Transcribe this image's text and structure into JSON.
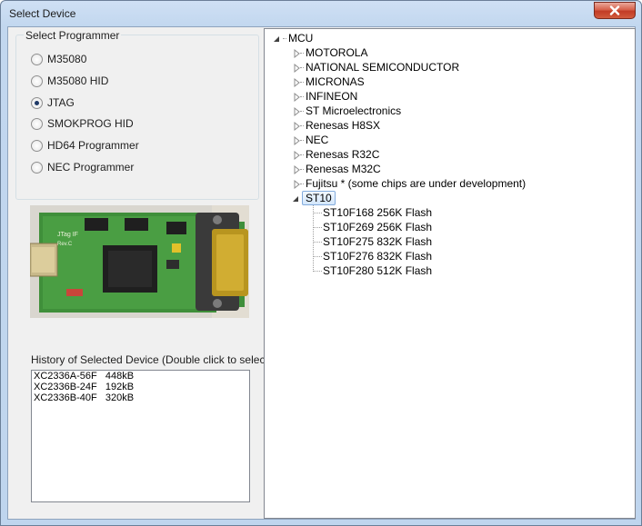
{
  "window": {
    "title": "Select Device"
  },
  "programmer": {
    "legend": "Select Programmer",
    "options": [
      {
        "label": "M35080",
        "selected": false
      },
      {
        "label": "M35080 HID",
        "selected": false
      },
      {
        "label": "JTAG",
        "selected": true
      },
      {
        "label": "SMOKPROG HID",
        "selected": false
      },
      {
        "label": "HD64 Programmer",
        "selected": false
      },
      {
        "label": "NEC Programmer",
        "selected": false
      }
    ]
  },
  "photo": {
    "subject": "JTAG interface circuit board",
    "silkscreen_text": "JTag IF",
    "revision_text": "Rev.C"
  },
  "history": {
    "label": "History of Selected Device (Double click to select)",
    "items": [
      "XC2336A-56F   448kB",
      "XC2336B-24F   192kB",
      "XC2336B-40F   320kB"
    ]
  },
  "tree": {
    "root": "MCU",
    "manufacturers": [
      "MOTOROLA",
      "NATIONAL SEMICONDUCTOR",
      "MICRONAS",
      "INFINEON",
      "ST Microelectronics",
      "Renesas H8SX",
      "NEC",
      "Renesas R32C",
      "Renesas M32C",
      "Fujitsu * (some chips are under development)"
    ],
    "expanded": "ST10",
    "devices": [
      "ST10F168 256K Flash",
      "ST10F269 256K Flash",
      "ST10F275 832K Flash",
      "ST10F276 832K Flash",
      "ST10F280 512K Flash"
    ]
  },
  "colors": {
    "titlebar": "#c2d7ef",
    "close_button": "#c94a33",
    "selection_border": "#84acdd"
  }
}
